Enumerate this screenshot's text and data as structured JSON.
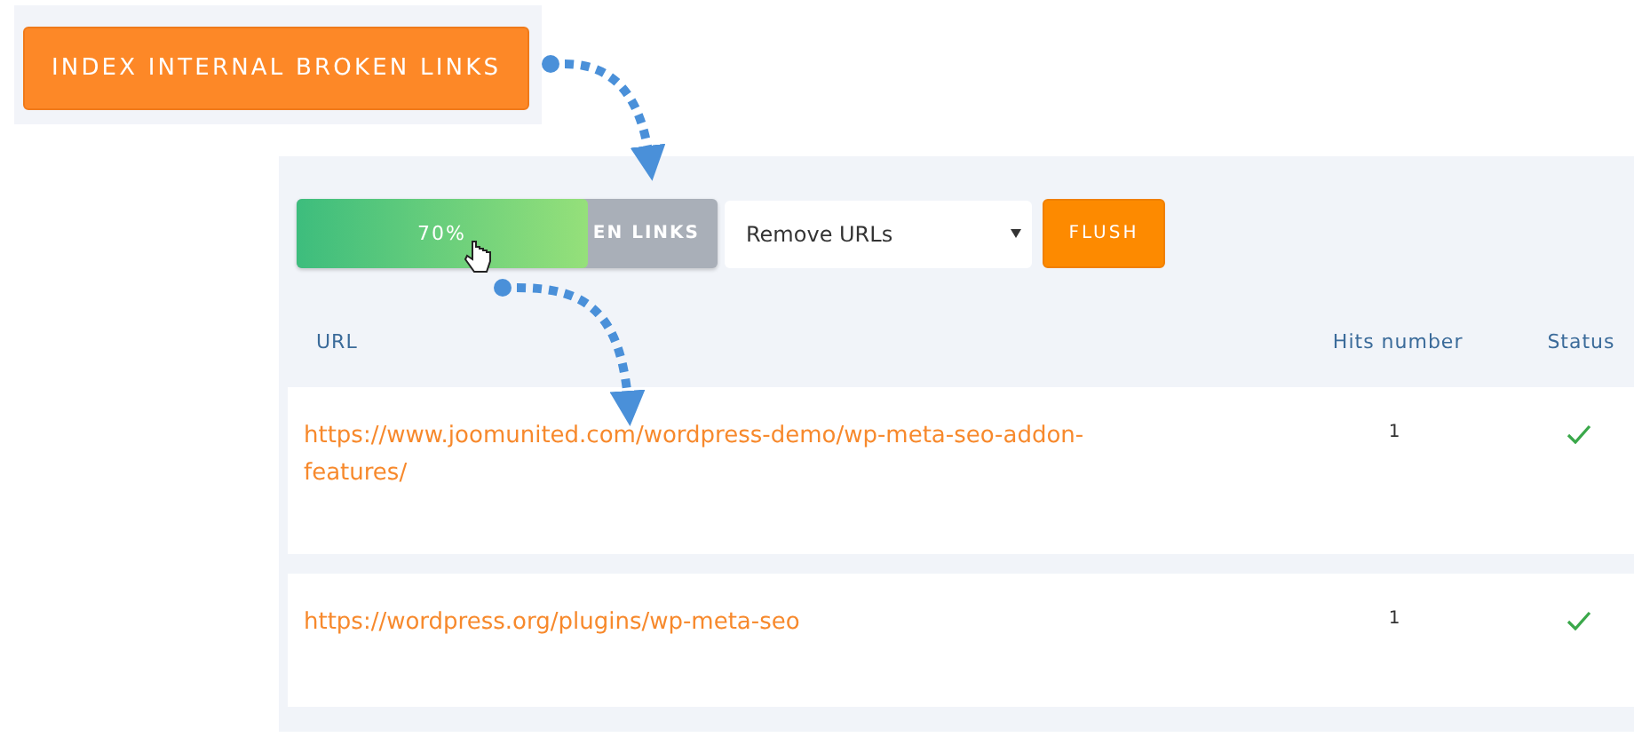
{
  "index_button": {
    "label": "INDEX INTERNAL BROKEN LINKS"
  },
  "progress": {
    "label": "70%",
    "level": 0.69,
    "covered_label": "EN LINKS"
  },
  "action_select": {
    "value": "Remove URLs"
  },
  "flush_button": {
    "label": "FLUSH"
  },
  "table": {
    "columns": [
      "URL",
      "Hits number",
      "Status"
    ],
    "rows": [
      {
        "url": "https://www.joomunited.com/wordpress-demo/wp-meta-seo-addon-features/",
        "hits": "1",
        "status_ok": true
      },
      {
        "url": "https://wordpress.org/plugins/wp-meta-seo",
        "hits": "1",
        "status_ok": true
      }
    ]
  }
}
